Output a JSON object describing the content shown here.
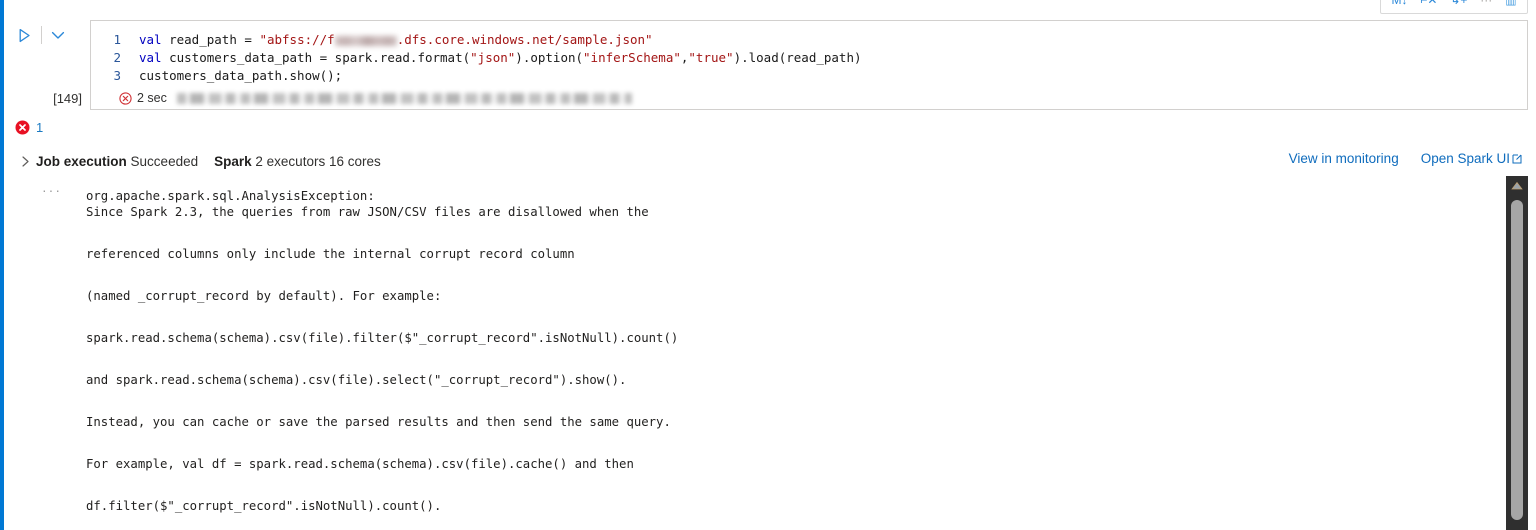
{
  "toolbar": {
    "icons": [
      {
        "name": "markdown-convert-icon",
        "glyph": "M↓"
      },
      {
        "name": "delete-cell-icon",
        "glyph": "⌐✕"
      },
      {
        "name": "insert-cell-icon",
        "glyph": "↳+"
      },
      {
        "name": "more-options-icon",
        "glyph": "···"
      },
      {
        "name": "trash-icon",
        "glyph": "▥"
      }
    ]
  },
  "run_controls": {
    "run_label": "▷",
    "run_name": "run-cell-button",
    "chevron_label": "⌄",
    "chevron_name": "run-options-chevron"
  },
  "cell": {
    "execution_count": "[149]",
    "code_lines": [
      {
        "number": "1",
        "segments": [
          {
            "cls": "k-kw",
            "text": "val "
          },
          {
            "cls": "k-pln",
            "text": "read_path "
          },
          {
            "cls": "k-pln",
            "text": "= "
          },
          {
            "cls": "k-str",
            "text": "\"abfss://f"
          },
          {
            "cls": "redact",
            "text": "",
            "width": 62
          },
          {
            "cls": "k-str",
            "text": ".dfs.core.windows.net/sample.json\""
          }
        ]
      },
      {
        "number": "2",
        "segments": [
          {
            "cls": "k-kw",
            "text": "val "
          },
          {
            "cls": "k-pln",
            "text": "customers_data_path = spark.read.format("
          },
          {
            "cls": "k-str",
            "text": "\"json\""
          },
          {
            "cls": "k-pln",
            "text": ").option("
          },
          {
            "cls": "k-str",
            "text": "\"inferSchema\""
          },
          {
            "cls": "k-pln",
            "text": ","
          },
          {
            "cls": "k-str",
            "text": "\"true\""
          },
          {
            "cls": "k-pln",
            "text": ").load(read_path)"
          }
        ]
      },
      {
        "number": "3",
        "segments": [
          {
            "cls": "k-pln",
            "text": "customers_data_path.show();"
          }
        ]
      }
    ],
    "status": {
      "icon_name": "error-circle-x-icon",
      "duration": "2 sec",
      "detail_redacted": true
    }
  },
  "error_badge": {
    "icon_name": "error-filled-icon",
    "count": "1"
  },
  "job_execution": {
    "twisty_name": "expand-job-execution-chevron",
    "label": "Job execution",
    "status": "Succeeded",
    "engine": "Spark",
    "resources": "2 executors 16 cores"
  },
  "links": [
    {
      "name": "view-in-monitoring-link",
      "label": "View in monitoring",
      "external": false
    },
    {
      "name": "open-spark-ui-link",
      "label": "Open Spark UI",
      "external": true
    }
  ],
  "output": {
    "overflow_glyph": "···",
    "trace_lines": [
      {
        "text": "org.apache.spark.sql.AnalysisException:",
        "spaced": false
      },
      {
        "text": "Since Spark 2.3, the queries from raw JSON/CSV files are disallowed when the",
        "spaced": false
      },
      {
        "text": "referenced columns only include the internal corrupt record column",
        "spaced": true
      },
      {
        "text": "(named _corrupt_record by default). For example:",
        "spaced": true
      },
      {
        "text": "spark.read.schema(schema).csv(file).filter($\"_corrupt_record\".isNotNull).count()",
        "spaced": true
      },
      {
        "text": "and spark.read.schema(schema).csv(file).select(\"_corrupt_record\").show().",
        "spaced": true
      },
      {
        "text": "Instead, you can cache or save the parsed results and then send the same query.",
        "spaced": true
      },
      {
        "text": "For example, val df = spark.read.schema(schema).csv(file).cache() and then",
        "spaced": true
      },
      {
        "text": "df.filter($\"_corrupt_record\".isNotNull).count().",
        "spaced": true
      }
    ]
  },
  "scrollbar": {
    "arrow_up_name": "scroll-up-arrow",
    "thumb_name": "scrollbar-thumb"
  },
  "colors": {
    "accent": "#0078d4",
    "link": "#0f6cbd",
    "error": "#d13438",
    "keyword": "#0000c0",
    "string": "#a31515"
  }
}
